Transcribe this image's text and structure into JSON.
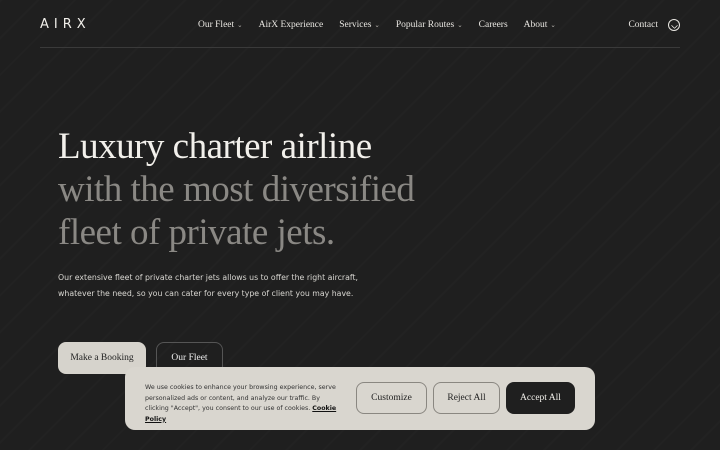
{
  "nav": {
    "logo": "AIRX",
    "items": [
      {
        "label": "Our Fleet",
        "dropdown": true
      },
      {
        "label": "AirX Experience",
        "dropdown": false
      },
      {
        "label": "Services",
        "dropdown": true
      },
      {
        "label": "Popular Routes",
        "dropdown": true
      },
      {
        "label": "Careers",
        "dropdown": false
      },
      {
        "label": "About",
        "dropdown": true
      }
    ],
    "contact": "Contact",
    "chevron": "⌄"
  },
  "hero": {
    "line1": "Luxury charter airline",
    "line2": "with the most diversified",
    "line3": "fleet of private jets.",
    "description_line1": "Our extensive fleet of private charter jets allows us to offer the right aircraft,",
    "description_line2": "whatever the need, so you can cater for every type of client you may have.",
    "primary_button": "Make a Booking",
    "secondary_button": "Our Fleet"
  },
  "cookie": {
    "text": "We use cookies to enhance your browsing experience, serve personalized ads or content, and analyze our traffic. By clicking \"Accept\", you consent to our use of cookies.",
    "policy_link": "Cookie Policy",
    "customize": "Customize",
    "reject": "Reject All",
    "accept": "Accept All"
  },
  "colors": {
    "background": "#1f1f1f",
    "muted_heading": "#8a8884",
    "cookie_bg": "#d9d6cf"
  }
}
